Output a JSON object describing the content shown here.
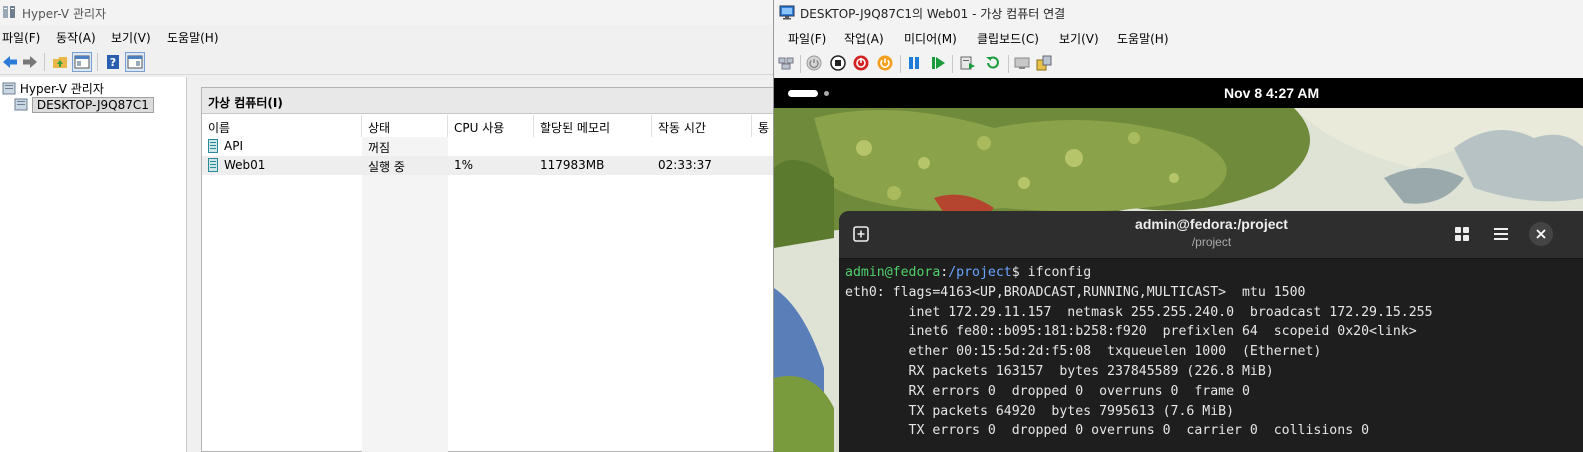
{
  "hyperv": {
    "title": "Hyper-V 관리자",
    "menu": [
      "파일(F)",
      "동작(A)",
      "보기(V)",
      "도움말(H)"
    ],
    "tree": {
      "root": "Hyper-V 관리자",
      "host": "DESKTOP-J9Q87C1"
    },
    "panel_title": "가상 컴퓨터(I)",
    "columns": [
      "이름",
      "상태",
      "CPU 사용",
      "할당된 메모리",
      "작동 시간",
      "통"
    ],
    "rows": [
      {
        "name": "API",
        "state": "꺼짐",
        "cpu": "",
        "memory": "",
        "uptime": ""
      },
      {
        "name": "Web01",
        "state": "실행 중",
        "cpu": "1%",
        "memory": "117983MB",
        "uptime": "02:33:37"
      }
    ]
  },
  "vmconnect": {
    "title": "DESKTOP-J9Q87C1의 Web01 - 가상 컴퓨터 연결",
    "menu": [
      "파일(F)",
      "작업(A)",
      "미디어(M)",
      "클립보드(C)",
      "보기(V)",
      "도움말(H)"
    ],
    "clock": "Nov 8   4:27 AM",
    "terminal": {
      "title": "admin@fedora:/project",
      "subtitle": "/project",
      "prompt_user": "admin@fedora",
      "prompt_sep": ":",
      "prompt_path": "/project",
      "prompt_end": "$ ",
      "command": "ifconfig",
      "output": [
        "eth0: flags=4163<UP,BROADCAST,RUNNING,MULTICAST>  mtu 1500",
        "        inet 172.29.11.157  netmask 255.255.240.0  broadcast 172.29.15.255",
        "        inet6 fe80::b095:181:b258:f920  prefixlen 64  scopeid 0x20<link>",
        "        ether 00:15:5d:2d:f5:08  txqueuelen 1000  (Ethernet)",
        "        RX packets 163157  bytes 237845589 (226.8 MiB)",
        "        RX errors 0  dropped 0  overruns 0  frame 0",
        "        TX packets 64920  bytes 7995613 (7.6 MiB)",
        "        TX errors 0  dropped 0 overruns 0  carrier 0  collisions 0"
      ]
    }
  },
  "colors": {
    "prompt_user": "#4fd06b",
    "prompt_path": "#6aa4ff",
    "terminal_bg": "#1e1e1e",
    "terminal_header": "#2e2e2e"
  },
  "icons": [
    "hyperv-manager-icon",
    "back-arrow-icon",
    "forward-arrow-icon",
    "folder-up-icon",
    "show-hide-tree-icon",
    "help-icon",
    "action-pane-icon",
    "server-icon",
    "vm-icon",
    "monitor-icon",
    "ctrl-alt-del-icon",
    "start-icon",
    "stop-icon",
    "shutdown-icon",
    "power-icon",
    "pause-icon",
    "resume-icon",
    "checkpoint-icon",
    "revert-icon",
    "enhanced-session-icon",
    "share-icon",
    "new-tab-icon",
    "grid-view-icon",
    "hamburger-menu-icon",
    "close-icon"
  ]
}
